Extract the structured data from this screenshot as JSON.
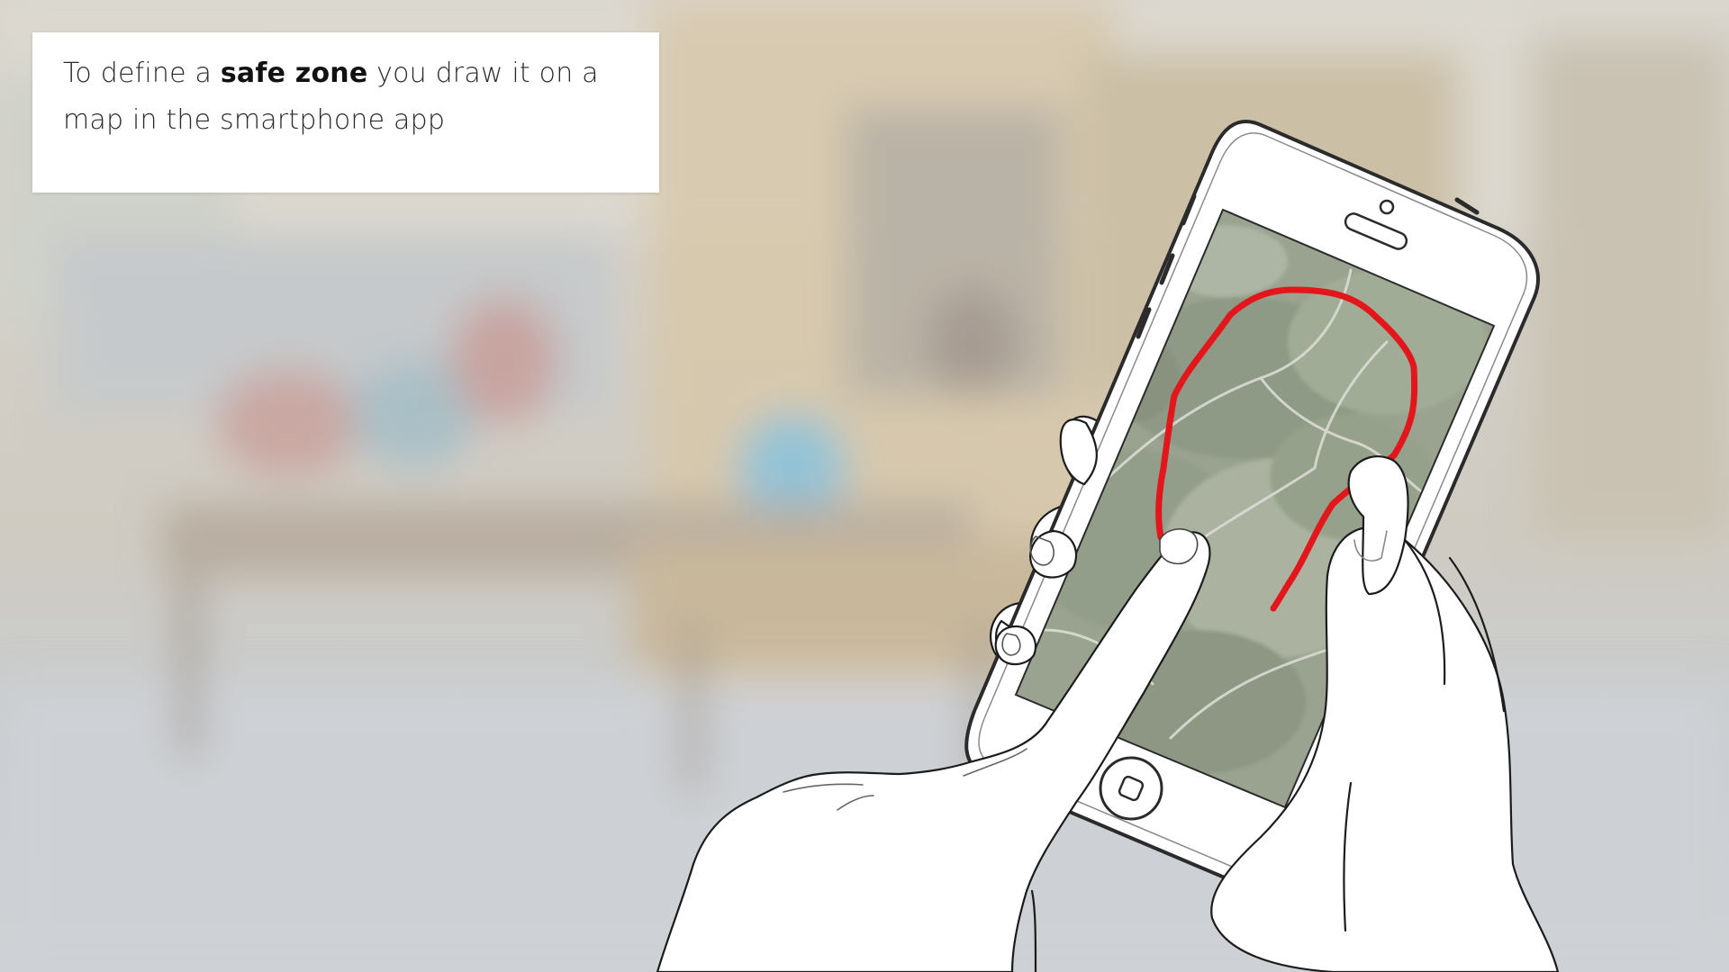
{
  "caption": {
    "prefix": "To define a ",
    "emphasis": "safe zone",
    "suffix": " you draw it on a map in the smartphone app"
  },
  "illustration": {
    "subject": "hands holding smartphone drawing on map",
    "drawn_path_color": "#e3161b",
    "background_style": "blurred classroom",
    "icons": [
      "smartphone-icon",
      "home-button-icon",
      "front-camera-icon",
      "speaker-icon"
    ]
  }
}
